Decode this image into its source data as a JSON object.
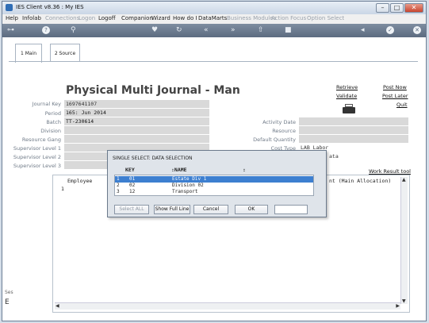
{
  "window": {
    "title": "IES Client v8.36 : My IES"
  },
  "menu": {
    "items": [
      {
        "label": "Help",
        "enabled": true
      },
      {
        "label": "Infolab",
        "enabled": true
      },
      {
        "label": "Connections",
        "enabled": false
      },
      {
        "label": "Logon",
        "enabled": false
      },
      {
        "label": "Logoff",
        "enabled": true
      },
      {
        "label": "Companion",
        "enabled": true
      },
      {
        "label": "Wizard",
        "enabled": true
      },
      {
        "label": "How do I",
        "enabled": true
      },
      {
        "label": "DataMarts",
        "enabled": true
      },
      {
        "label": "Business Modules",
        "enabled": false
      },
      {
        "label": "Action Focus",
        "enabled": false
      },
      {
        "label": "Option Select",
        "enabled": false
      }
    ]
  },
  "tabs": [
    {
      "label": "1 Main"
    },
    {
      "label": "2 Source"
    }
  ],
  "form": {
    "title": "Physical Multi Journal - Man",
    "links": {
      "retrieve": "Retrieve",
      "validate": "Validate",
      "post_now": "Post Now",
      "post_later": "Post Later",
      "quit": "Quit"
    },
    "left_fields": [
      {
        "label": "Journal Key",
        "value": "1697641107"
      },
      {
        "label": "Period",
        "value": "165: Jun 2014"
      },
      {
        "label": "Batch",
        "value": "TT-230614"
      },
      {
        "label": "Division",
        "value": ""
      },
      {
        "label": "Resource Gang",
        "value": ""
      },
      {
        "label": "Supervisor Level 1",
        "value": ""
      },
      {
        "label": "Supervisor Level 2",
        "value": ""
      },
      {
        "label": "Supervisor Level 3",
        "value": ""
      }
    ],
    "right_fields": [
      {
        "label": "Activity Date",
        "value": ""
      },
      {
        "label": "Resource",
        "value": ""
      },
      {
        "label": "Default Quantity",
        "value": ""
      },
      {
        "label": "Cost Type",
        "value": "LAB Labor"
      },
      {
        "label": "",
        "value": "ata"
      }
    ],
    "work_result_link": "Work Result tool"
  },
  "grid": {
    "col_employee": "Employee",
    "col_right": "nt (Main Allocation)",
    "row_number": "1",
    "side_label": "Ses",
    "side_label2": "E"
  },
  "dialog": {
    "title": "SINGLE SELECT: DATA SELECTION",
    "headers": {
      "key": "KEY",
      "name": ":NAME",
      "colon": ":"
    },
    "rows": [
      {
        "num": "1",
        "key": "01",
        "name": "Estate Div 1",
        "selected": true
      },
      {
        "num": "2",
        "key": "02",
        "name": "Division 02",
        "selected": false
      },
      {
        "num": "3",
        "key": "12",
        "name": "Transport",
        "selected": false
      }
    ],
    "buttons": {
      "select_all": "Select ALL",
      "show_full_line": "Show Full Line",
      "cancel": "Cancel",
      "ok": "OK"
    }
  }
}
